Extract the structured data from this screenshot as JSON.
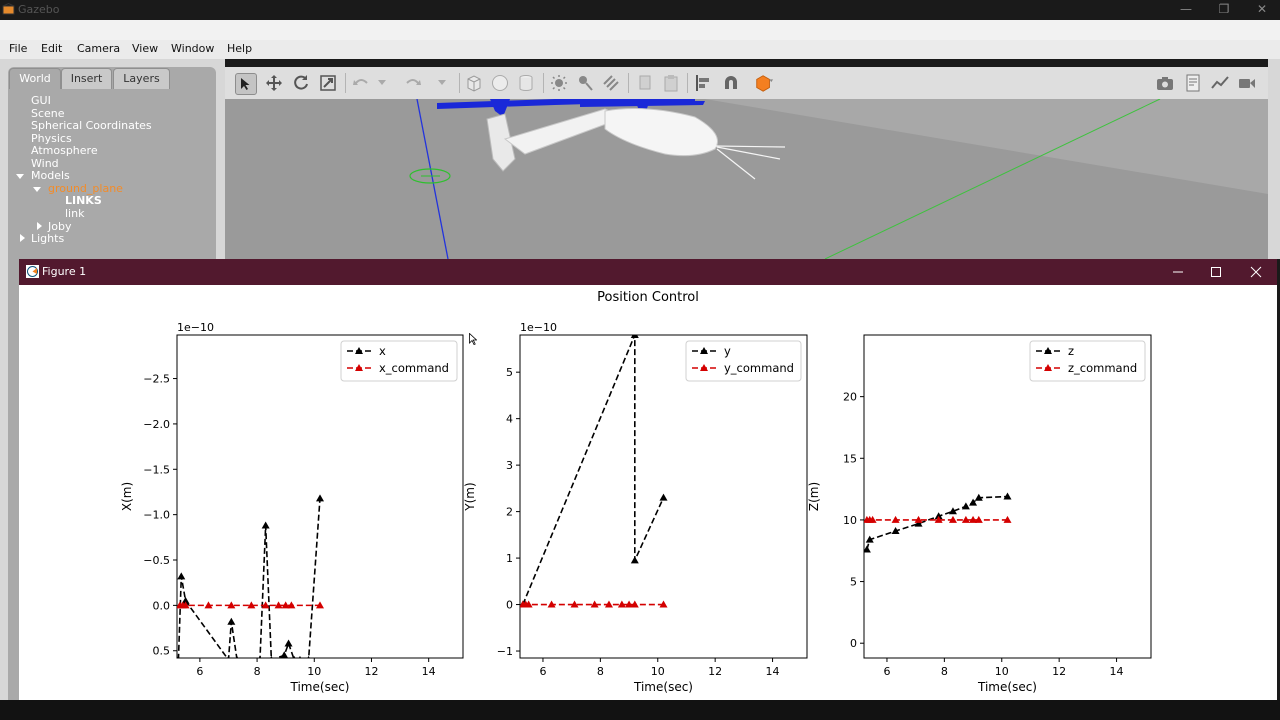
{
  "gazebo": {
    "title": "Gazebo",
    "menu": [
      "File",
      "Edit",
      "Camera",
      "View",
      "Window",
      "Help"
    ],
    "tabs": [
      "World",
      "Insert",
      "Layers"
    ],
    "tree": {
      "gui": "GUI",
      "scene": "Scene",
      "spherical": "Spherical Coordinates",
      "physics": "Physics",
      "atmosphere": "Atmosphere",
      "wind": "Wind",
      "models": "Models",
      "ground_plane": "ground_plane",
      "links": "LINKS",
      "link": "link",
      "joby": "Joby",
      "lights": "Lights"
    }
  },
  "figure": {
    "window_title": "Figure 1",
    "suptitle": "Position Control"
  },
  "chart_data": [
    {
      "type": "line",
      "title": "",
      "xlabel": "Time(sec)",
      "ylabel": "X(m)",
      "offset_label": "1e−10",
      "y_inverted": true,
      "xlim": [
        5.2,
        15.2
      ],
      "ylim": [
        0.58,
        -2.98
      ],
      "xticks": [
        6,
        8,
        10,
        12,
        14
      ],
      "yticks": [
        -2.5,
        -2.0,
        -1.5,
        -1.0,
        -0.5,
        0.0,
        0.5
      ],
      "ytick_labels": [
        "−2.5",
        "−2.0",
        "−1.5",
        "−1.0",
        "−0.5",
        "0.0",
        "0.5"
      ],
      "legend": "top-right",
      "series": [
        {
          "name": "x",
          "color": "#000000",
          "style": "dashed",
          "marker": "triangle",
          "x": [
            5.25,
            5.35,
            5.5,
            7.0,
            7.1,
            7.3,
            8.1,
            8.3,
            8.5,
            8.95,
            9.1,
            9.3,
            9.5,
            9.8,
            10.2
          ],
          "y": [
            0.6,
            -0.32,
            -0.05,
            0.6,
            0.18,
            0.6,
            0.6,
            -0.88,
            0.6,
            0.55,
            0.42,
            0.6,
            0.6,
            0.6,
            -1.18
          ]
        },
        {
          "name": "x_command",
          "color": "#d40000",
          "style": "dashed",
          "marker": "triangle",
          "x": [
            5.3,
            5.4,
            5.5,
            6.3,
            7.1,
            7.8,
            8.3,
            8.75,
            9.0,
            9.2,
            10.2
          ],
          "y": [
            0,
            0,
            0,
            0,
            0,
            0,
            0,
            0,
            0,
            0,
            0
          ]
        }
      ]
    },
    {
      "type": "line",
      "title": "",
      "xlabel": "Time(sec)",
      "ylabel": "Y(m)",
      "offset_label": "1e−10",
      "xlim": [
        5.2,
        15.2
      ],
      "ylim": [
        -1.15,
        5.8
      ],
      "xticks": [
        6,
        8,
        10,
        12,
        14
      ],
      "yticks": [
        -1,
        0,
        1,
        2,
        3,
        4,
        5
      ],
      "ytick_labels": [
        "−1",
        "0",
        "1",
        "2",
        "3",
        "4",
        "5"
      ],
      "legend": "top-right",
      "series": [
        {
          "name": "y",
          "color": "#000000",
          "style": "dashed",
          "marker": "triangle",
          "x": [
            5.3,
            9.2,
            9.2,
            10.2
          ],
          "y": [
            0.0,
            5.8,
            0.95,
            2.3
          ]
        },
        {
          "name": "y_command",
          "color": "#d40000",
          "style": "dashed",
          "marker": "triangle",
          "x": [
            5.3,
            5.4,
            5.5,
            6.3,
            7.1,
            7.8,
            8.3,
            8.75,
            9.0,
            9.2,
            10.2
          ],
          "y": [
            0,
            0,
            0,
            0,
            0,
            0,
            0,
            0,
            0,
            0,
            0
          ]
        }
      ]
    },
    {
      "type": "line",
      "title": "",
      "xlabel": "Time(sec)",
      "ylabel": "Z(m)",
      "xlim": [
        5.2,
        15.2
      ],
      "ylim": [
        -1.2,
        25.0
      ],
      "xticks": [
        6,
        8,
        10,
        12,
        14
      ],
      "yticks": [
        0,
        5,
        10,
        15,
        20
      ],
      "ytick_labels": [
        "0",
        "5",
        "10",
        "15",
        "20"
      ],
      "legend": "top-right",
      "series": [
        {
          "name": "z",
          "color": "#000000",
          "style": "dashed",
          "marker": "triangle",
          "x": [
            5.3,
            5.4,
            6.3,
            7.1,
            7.8,
            8.3,
            8.75,
            9.0,
            9.2,
            10.2
          ],
          "y": [
            7.6,
            8.4,
            9.1,
            9.7,
            10.3,
            10.7,
            11.1,
            11.4,
            11.8,
            11.9
          ]
        },
        {
          "name": "z_command",
          "color": "#d40000",
          "style": "dashed",
          "marker": "triangle",
          "x": [
            5.3,
            5.4,
            5.5,
            6.3,
            7.1,
            7.8,
            8.3,
            8.75,
            9.0,
            9.2,
            10.2
          ],
          "y": [
            10,
            10,
            10,
            10,
            10,
            10,
            10,
            10,
            10,
            10,
            10
          ]
        }
      ]
    }
  ]
}
